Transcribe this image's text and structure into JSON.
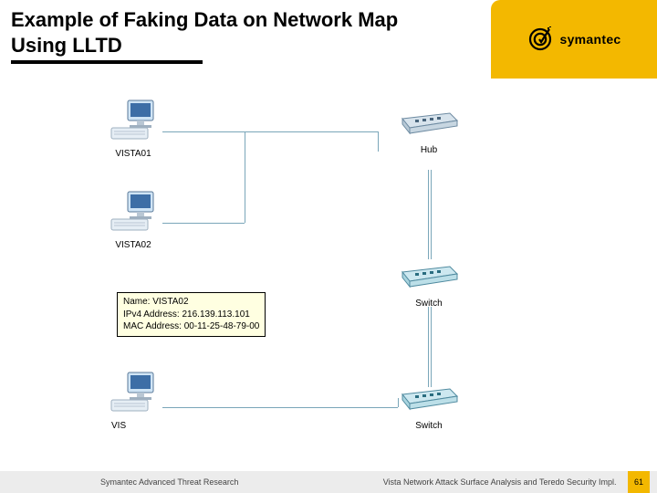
{
  "header": {
    "title": "Example of Faking Data on Network Map Using LLTD",
    "brand": "symantec"
  },
  "diagram": {
    "hosts": {
      "vista01": "VISTA01",
      "vista02": "VISTA02",
      "vista03_prefix": "VIS"
    },
    "devices": {
      "hub": "Hub",
      "switch1": "Switch",
      "switch2": "Switch"
    },
    "tooltip": {
      "name_label": "Name:",
      "name_value": "VISTA02",
      "ip_label": "IPv4 Address:",
      "ip_value": "216.139.113.101",
      "mac_label": "MAC Address:",
      "mac_value": "00-11-25-48-79-00"
    }
  },
  "footer": {
    "left": "Symantec Advanced Threat Research",
    "right": "Vista Network Attack Surface Analysis and Teredo Security Impl.",
    "page": "61"
  }
}
